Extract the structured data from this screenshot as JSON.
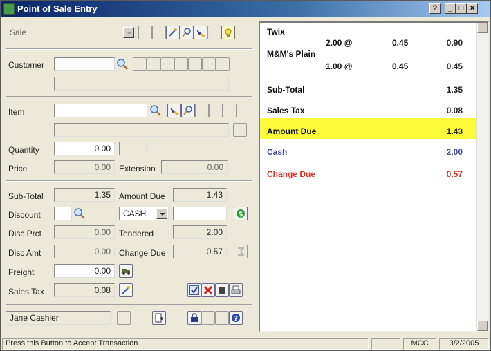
{
  "window": {
    "title": "Point of Sale Entry"
  },
  "titlebar_buttons": [
    "?",
    "_",
    "□",
    "×"
  ],
  "form": {
    "mode_value": "Sale",
    "customer_label": "Customer",
    "customer_value": "",
    "customer_name": "",
    "item_label": "Item",
    "item_value": "",
    "item_desc": "",
    "quantity_label": "Quantity",
    "quantity_value": "0.00",
    "price_label": "Price",
    "price_value": "0.00",
    "extension_label": "Extension",
    "extension_value": "0.00",
    "subtotal_label": "Sub-Total",
    "subtotal_value": "1.35",
    "amount_due_label": "Amount Due",
    "amount_due_value": "1.43",
    "discount_label": "Discount",
    "discount_value": "",
    "payment_type": "CASH",
    "payment_ref": "",
    "disc_prct_label": "Disc Prct",
    "disc_prct_value": "0.00",
    "tendered_label": "Tendered",
    "tendered_value": "2.00",
    "disc_amt_label": "Disc Amt",
    "disc_amt_value": "0.00",
    "change_due_label": "Change Due",
    "change_due_value": "0.57",
    "freight_label": "Freight",
    "freight_value": "0.00",
    "sales_tax_label": "Sales Tax",
    "sales_tax_value": "0.08",
    "cashier_value": "Jane Cashier"
  },
  "receipt": {
    "items": [
      {
        "name": "Twix",
        "qty": "2.00 @",
        "price": "0.45",
        "total": "0.90"
      },
      {
        "name": "M&M's Plain",
        "qty": "1.00 @",
        "price": "0.45",
        "total": "0.45"
      }
    ],
    "subtotal_label": "Sub-Total",
    "subtotal_value": "1.35",
    "tax_label": "Sales Tax",
    "tax_value": "0.08",
    "amount_due_label": "Amount Due",
    "amount_due_value": "1.43",
    "cash_label": "Cash",
    "cash_value": "2.00",
    "change_label": "Change Due",
    "change_value": "0.57"
  },
  "status": {
    "message": "Press this Button to Accept Transaction",
    "mcc": "MCC",
    "date": "3/2/2005"
  },
  "colors": {
    "title_bar": "#0a246a",
    "highlight": "#fbfb3a",
    "cash": "#4a4aa0",
    "change": "#e03020"
  },
  "icons": [
    "app-icon",
    "search-icon",
    "lookup-icon",
    "wand-icon",
    "flashlight-icon",
    "lightbulb-icon",
    "printer-icon",
    "cash-icon",
    "truck-icon",
    "accept-icon",
    "delete-icon",
    "trash-icon",
    "print-icon",
    "lock-icon",
    "help-icon",
    "new-doc-icon",
    "calc-icon"
  ]
}
